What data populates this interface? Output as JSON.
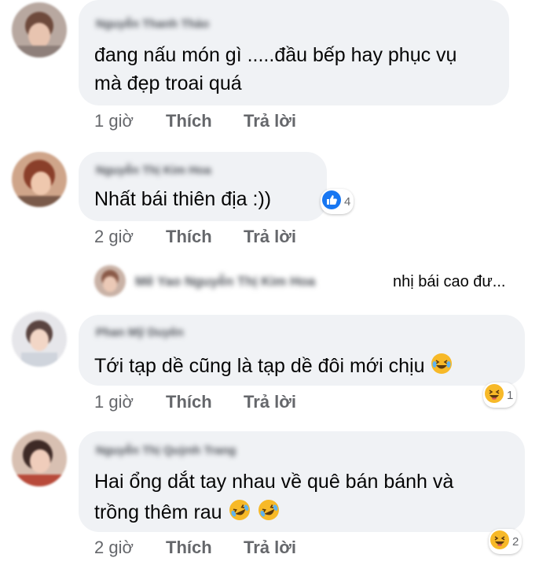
{
  "comments": [
    {
      "author": "Nguyễn Thanh Thảo",
      "lines": [
        "đang nấu món gì .....đầu bếp hay phục vụ",
        "mà đẹp troai quá"
      ],
      "time": "1 giờ",
      "like": "Thích",
      "reply": "Trả lời"
    },
    {
      "author": "Nguyễn Thị Kim Hoa",
      "lines": [
        "Nhất bái thiên địa :))"
      ],
      "time": "2 giờ",
      "like": "Thích",
      "reply": "Trả lời",
      "reaction": {
        "icon": "like-icon",
        "count": "4"
      }
    },
    {
      "author": "Phan Mỹ Duyên",
      "lines": [
        "Tới tạp dề cũng là tạp dề đôi mới chịu"
      ],
      "time": "1 giờ",
      "like": "Thích",
      "reply": "Trả lời",
      "reaction": {
        "icon": "haha-icon",
        "count": "1"
      }
    },
    {
      "author": "Nguyễn Thị Quỳnh Trang",
      "lines": [
        "Hai ổng dắt tay nhau về quê bán bánh và",
        "trồng thêm rau"
      ],
      "time": "2 giờ",
      "like": "Thích",
      "reply": "Trả lời",
      "reaction": {
        "icon": "haha-icon",
        "count": "2"
      }
    }
  ],
  "reply_preview": {
    "author": "Mê Yao Nguyễn Thị Kim Hoa",
    "text": "nhị bái cao đư..."
  },
  "colors": {
    "bubble": "#f0f2f5",
    "secondary_text": "#65676b",
    "like_blue": "#1877f2",
    "haha_yellow": "#f7b928"
  }
}
